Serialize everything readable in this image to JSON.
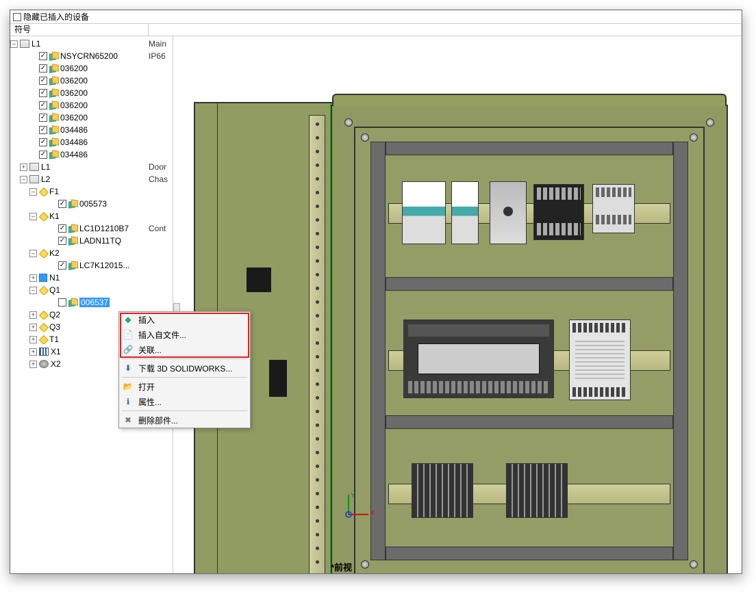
{
  "header": {
    "hide_inserted_label": "隐藏已插入的设备"
  },
  "columns": {
    "symbol": "符号",
    "description": ""
  },
  "tree": {
    "l1": {
      "label": "L1",
      "desc": "Main"
    },
    "l1_items": [
      {
        "label": "NSYCRN65200",
        "desc": "IP66"
      },
      {
        "label": "036200",
        "desc": ""
      },
      {
        "label": "036200",
        "desc": ""
      },
      {
        "label": "036200",
        "desc": ""
      },
      {
        "label": "036200",
        "desc": ""
      },
      {
        "label": "036200",
        "desc": ""
      },
      {
        "label": "034486",
        "desc": ""
      },
      {
        "label": "034486",
        "desc": ""
      },
      {
        "label": "034486",
        "desc": ""
      }
    ],
    "l1b": {
      "label": "L1",
      "desc": "Door"
    },
    "l2": {
      "label": "L2",
      "desc": "Chas"
    },
    "f1": {
      "label": "F1"
    },
    "f1_item": {
      "label": "005573"
    },
    "k1": {
      "label": "K1"
    },
    "k1_items": [
      {
        "label": "LC1D1210B7",
        "desc": "Cont"
      },
      {
        "label": "LADN11TQ",
        "desc": ""
      }
    ],
    "k2": {
      "label": "K2"
    },
    "k2_item": {
      "label": "LC7K12015..."
    },
    "n1": {
      "label": "N1"
    },
    "q1": {
      "label": "Q1"
    },
    "q1_item": {
      "label": "006537"
    },
    "q2": {
      "label": "Q2"
    },
    "q3": {
      "label": "Q3"
    },
    "t1": {
      "label": "T1"
    },
    "x1": {
      "label": "X1"
    },
    "x2": {
      "label": "X2"
    }
  },
  "context_menu": {
    "insert": "插入",
    "insert_from_file": "插入自文件...",
    "associate": "关联...",
    "download_sw": "下载 3D SOLIDWORKS...",
    "open": "打开",
    "properties": "属性...",
    "delete_part": "删除部件..."
  },
  "axis": {
    "x": "X",
    "y": "Y"
  },
  "view_label": "*前视"
}
